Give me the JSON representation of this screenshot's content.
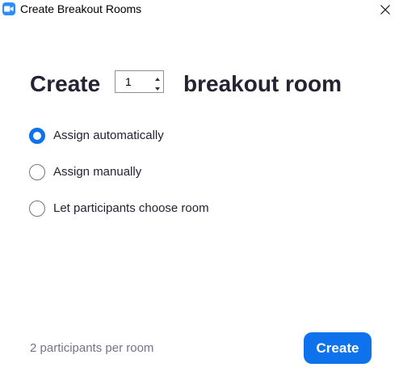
{
  "window": {
    "title": "Create Breakout Rooms",
    "app_icon": "zoom-camera-icon",
    "close_icon": "close-icon"
  },
  "headline": {
    "prefix": "Create",
    "room_count": "1",
    "suffix": "breakout room"
  },
  "options": [
    {
      "label": "Assign automatically",
      "selected": true
    },
    {
      "label": "Assign manually",
      "selected": false
    },
    {
      "label": "Let participants choose room",
      "selected": false
    }
  ],
  "footer": {
    "participants_per_room": "2 participants per room",
    "create_label": "Create"
  },
  "colors": {
    "accent": "#0e72ed",
    "app_icon": "#2d8cff",
    "text": "#232333",
    "muted_text": "#747487"
  }
}
